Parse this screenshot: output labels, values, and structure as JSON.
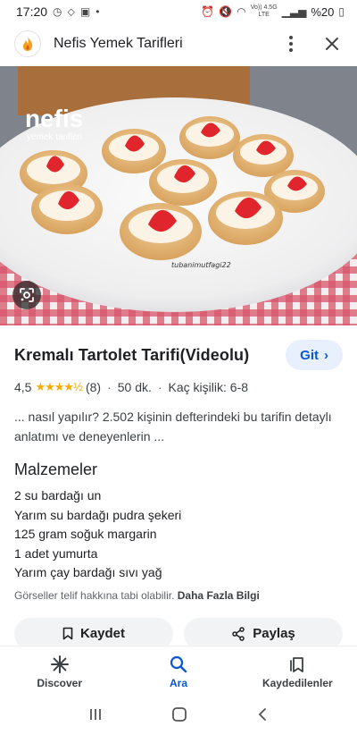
{
  "status_bar": {
    "time": "17:20",
    "network": "Vo)) 4.5G LTE",
    "battery": "%20"
  },
  "header": {
    "site_name": "Nefis Yemek Tarifleri",
    "more_icon": "more-vert-icon",
    "close_icon": "close-icon"
  },
  "image": {
    "watermark_brand": "nefis",
    "watermark_sub": "yemek tarifleri",
    "photo_credit": "tubanimutfagi22"
  },
  "result": {
    "title": "Kremalı Tartolet Tarifi(Videolu)",
    "go_label": "Git",
    "rating": "4,5",
    "stars": "★★★★½",
    "review_count": "(8)",
    "duration": "50 dk.",
    "servings": "Kaç kişilik: 6-8",
    "snippet": "... nasıl yapılır? 2.502 kişinin defterindeki bu tarifin detaylı anlatımı ve deneyenlerin ...",
    "ingredients_title": "Malzemeler",
    "ingredients": [
      "2 su bardağı un",
      "Yarım su bardağı pudra şekeri",
      "125 gram soğuk margarin",
      "1 adet yumurta",
      "Yarım çay bardağı sıvı yağ"
    ],
    "copyright_text": "Görseller telif hakkına tabi olabilir.",
    "copyright_link": "Daha Fazla Bilgi",
    "save_label": "Kaydet",
    "share_label": "Paylaş"
  },
  "bottom_nav": {
    "items": [
      {
        "label": "Discover",
        "icon": "asterisk-icon"
      },
      {
        "label": "Ara",
        "icon": "search-icon"
      },
      {
        "label": "Kaydedilenler",
        "icon": "bookmarks-icon"
      }
    ],
    "active": "Ara"
  },
  "colors": {
    "accent": "#0b57d0",
    "go_button_bg": "#e8f0fe",
    "star": "#f9ab00",
    "button_bg": "#f1f3f4"
  }
}
